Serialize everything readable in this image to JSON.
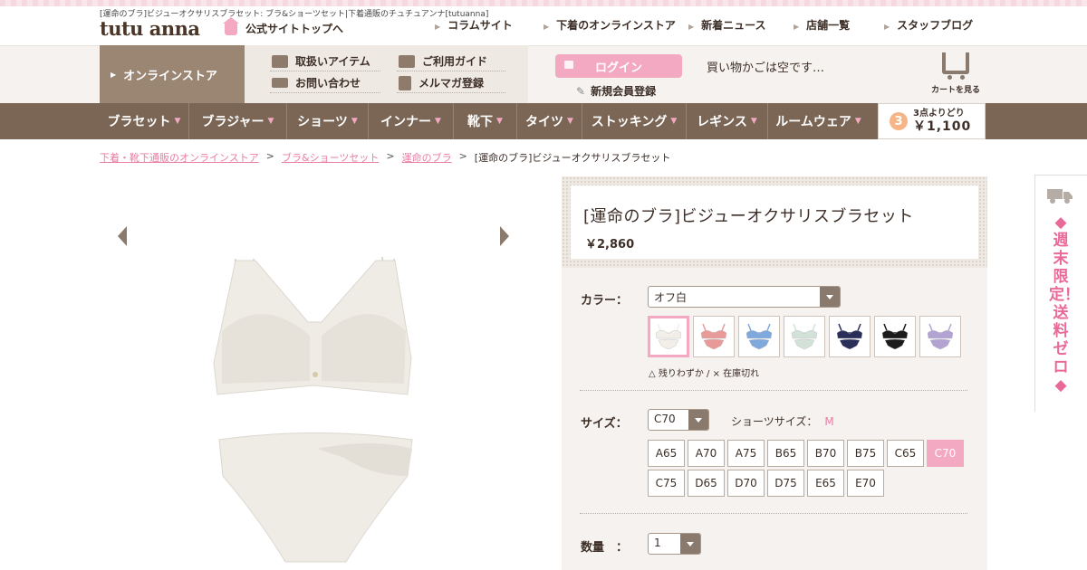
{
  "header": {
    "seo_text": "[運命のブラ]ビジューオクサリスブラセット: ブラ&ショーツセット|下着通販のチュチュアンナ[tutuanna]",
    "logo": "tutu anna",
    "home_link": "公式サイトトップへ",
    "top_nav": [
      "コラムサイト",
      "下着のオンラインストア",
      "新着ニュース",
      "店舗一覧",
      "スタッフブログ"
    ]
  },
  "subbar": {
    "store_tab": "オンラインストア",
    "links": [
      "取扱いアイテム",
      "ご利用ガイド",
      "お問い合わせ",
      "メルマガ登録"
    ],
    "login": "ログイン",
    "register": "新規会員登録",
    "cart_message": "買い物かごは空です…",
    "cart_label": "カートを見る"
  },
  "categories": [
    "ブラセット",
    "ブラジャー",
    "ショーツ",
    "インナー",
    "靴下",
    "タイツ",
    "ストッキング",
    "レギンス",
    "ルームウェア"
  ],
  "promo": {
    "number": "3",
    "line1": "3点よりどり",
    "line2": "￥1,100"
  },
  "breadcrumb": [
    "下着・靴下通販のオンラインストア",
    "ブラ&ショーツセット",
    "運命のブラ",
    "[運命のブラ]ビジューオクサリスブラセット"
  ],
  "product": {
    "title": "[運命のブラ]ビジューオクサリスブラセット",
    "price": "￥2,860",
    "color_label": "カラー：",
    "color_value": "オフ白",
    "swatch_colors": [
      "#f2efe9",
      "#e79a98",
      "#7fa8dc",
      "#d3e2d9",
      "#2a2f5a",
      "#1b1b1b",
      "#b3a3d3"
    ],
    "stock_note": "△ 残りわずか / × 在庫切れ",
    "size_label": "サイズ：",
    "size_value": "C70",
    "shorts_label": "ショーツサイズ：",
    "shorts_value": "M",
    "sizes": [
      "A65",
      "A70",
      "A75",
      "B65",
      "B70",
      "B75",
      "C65",
      "C70",
      "C75",
      "D65",
      "D70",
      "D75",
      "E65",
      "E70"
    ],
    "selected_size": "C70",
    "qty_label": "数量　：",
    "qty_value": "1"
  },
  "side_banner": "◆週末限定！送料ゼロ◆"
}
